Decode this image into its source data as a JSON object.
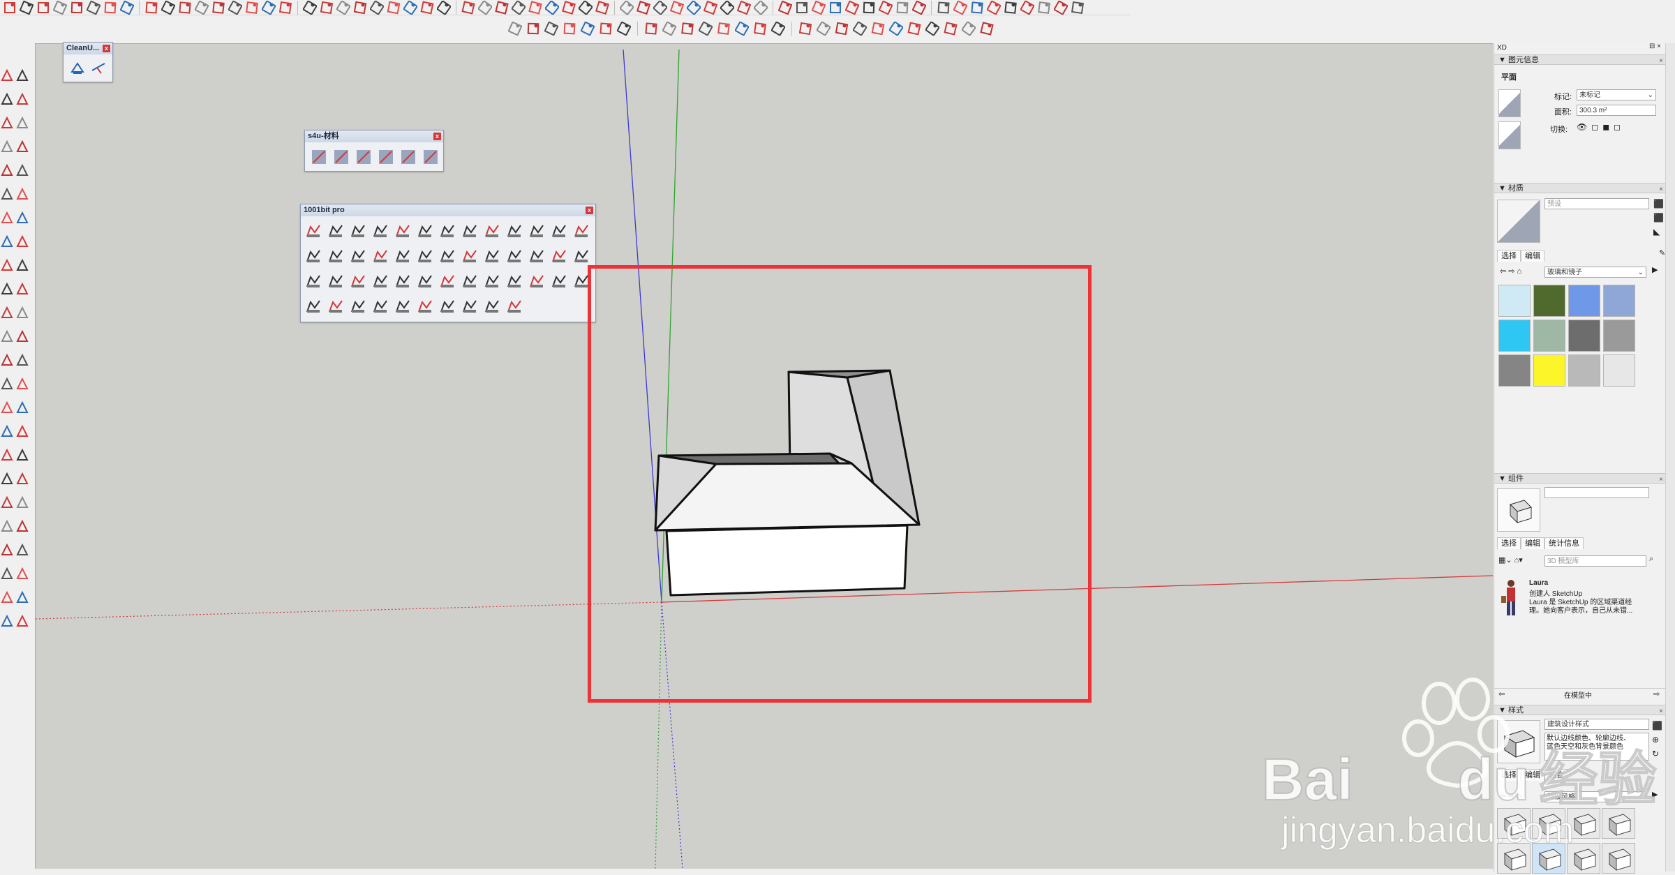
{
  "toolbars": {
    "cleanup_title": "CleanU...",
    "s4u_title": "s4u-材料",
    "bit_title": "1001bit pro",
    "close_glyph": "x"
  },
  "entity_info": {
    "panel_title": "XD",
    "header": "图元信息",
    "entity_type": "平面",
    "tag_label": "标记:",
    "tag_value": "未标记",
    "area_label": "面积:",
    "area_value": "300.3 m²",
    "toggle_label": "切换:"
  },
  "materials": {
    "header": "材质",
    "material_name": "预设",
    "tab_select": "选择",
    "tab_edit": "编辑",
    "library": "玻璃和镜子",
    "swatch_colors": [
      "#cfe9f5",
      "#4f6a2c",
      "#6f98e8",
      "#8fa7d6",
      "#2ec6f2",
      "#9fb7a5",
      "#6d6d6d",
      "#9a9a9a",
      "#858585",
      "#fbf52a",
      "#b9b9b9",
      "#e7e7e7"
    ]
  },
  "components": {
    "header": "组件",
    "tab_select": "选择",
    "tab_edit": "编辑",
    "tab_stats": "统计信息",
    "search_placeholder": "3D 模型库",
    "item_name": "Laura",
    "item_desc_1": "创建人 SketchUp",
    "item_desc_2": "Laura 是 SketchUp 的区域渠道经",
    "item_desc_3": "理。她向客户表示，自己从未错...",
    "footer": "在模型中"
  },
  "styles": {
    "header": "样式",
    "style_name": "建筑设计样式",
    "style_desc_1": "默认边线颜色、轮廓边线、",
    "style_desc_2": "蓝色天空和灰色背景颜色",
    "tab_select": "选择",
    "tab_edit": "编辑",
    "tab_mix": "混合",
    "library": "预设风格"
  },
  "watermark": {
    "brand": "Bai",
    "brand2": "du",
    "suffix": "经验",
    "url": "jingyan.baidu.com"
  },
  "colors": {
    "accent_red": "#ee3338",
    "axis_red": "#d23c3c",
    "axis_green": "#2fa52f",
    "axis_blue": "#3a3ad0",
    "viewport_bg": "#cfcfcb"
  }
}
